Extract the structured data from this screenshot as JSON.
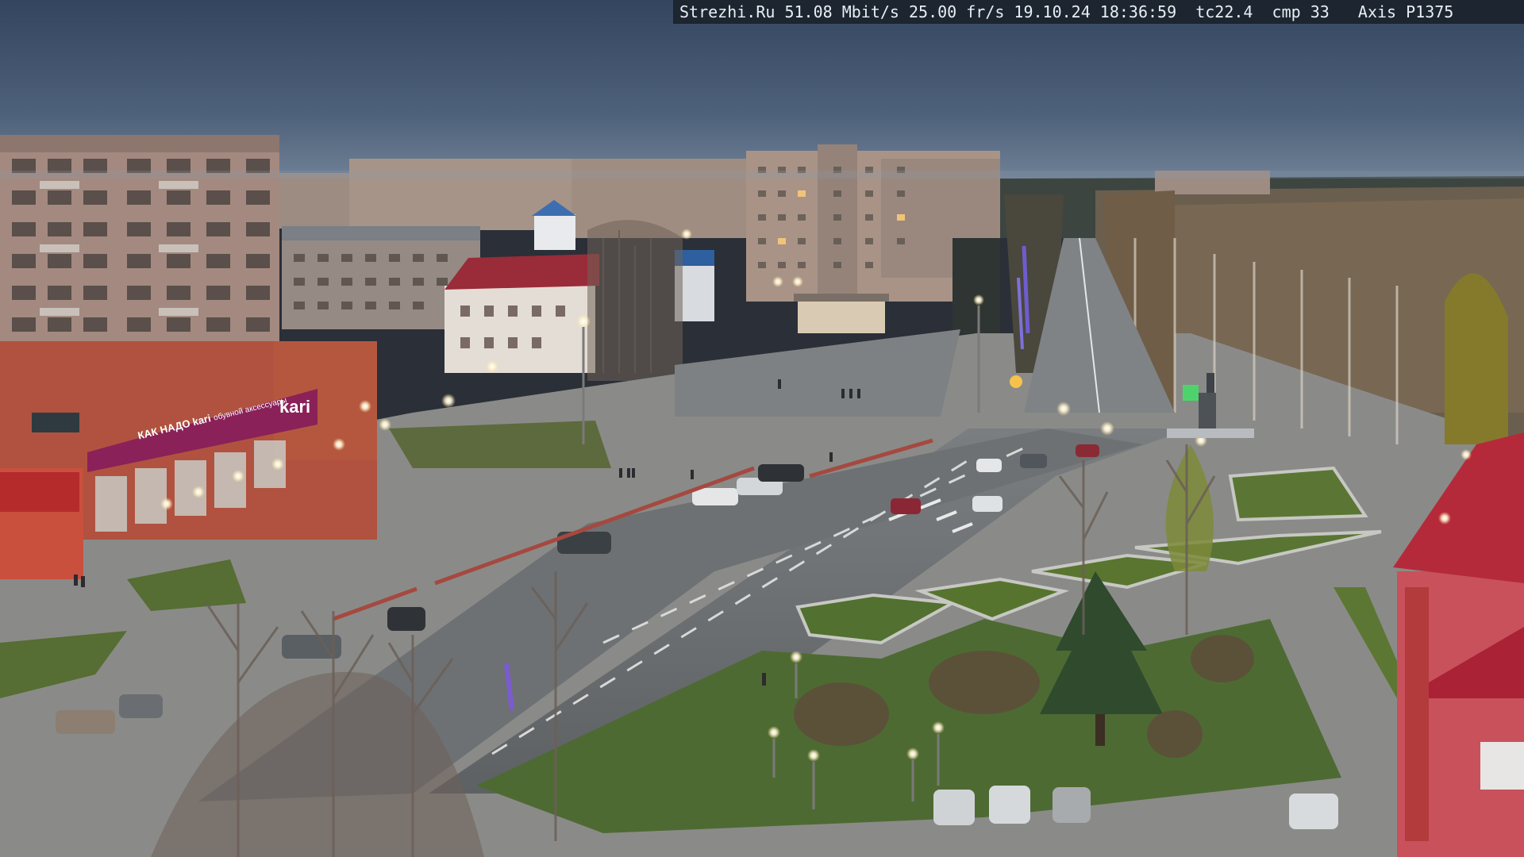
{
  "camera_overlay": {
    "text": "Strezhi.Ru 51.08 Mbit/s 25.00 fr/s 19.10.24 18:36:59  tc22.4  cmp 33   Axis P1375"
  },
  "signage": {
    "store_sign": "kari",
    "store_banner": "КАК НАДО kari",
    "store_sub": "обувной аксессуары"
  },
  "colors": {
    "sky_top": "#3b4e6a",
    "sky_bottom": "#6d7f93",
    "brick": "#a88a80",
    "store_red": "#9c2d35",
    "store_purple": "#8a2158",
    "grass": "#4f6a35",
    "asphalt": "#6e7275",
    "roof_red": "#b52a3a"
  }
}
